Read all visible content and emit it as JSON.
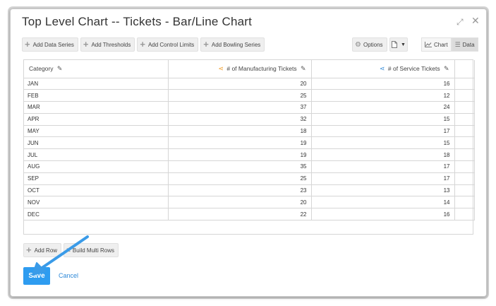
{
  "dialog": {
    "title": "Top Level Chart -- Tickets - Bar/Line Chart",
    "expand_glyph": "⤢",
    "close_glyph": "✕"
  },
  "toolbar": {
    "add_data_series": "Add Data Series",
    "add_thresholds": "Add Thresholds",
    "add_control_limits": "Add Control Limits",
    "add_bowling_series": "Add Bowling Series",
    "options": "Options",
    "chart_tab": "Chart",
    "data_tab": "Data",
    "active_tab": "Data"
  },
  "table": {
    "headers": {
      "category": "Category",
      "manufacturing": "# of Manufacturing Tickets",
      "service": "# of Service Tickets"
    },
    "rows": [
      {
        "category": "JAN",
        "mfg": "20",
        "svc": "16"
      },
      {
        "category": "FEB",
        "mfg": "25",
        "svc": "12"
      },
      {
        "category": "MAR",
        "mfg": "37",
        "svc": "24"
      },
      {
        "category": "APR",
        "mfg": "32",
        "svc": "15"
      },
      {
        "category": "MAY",
        "mfg": "18",
        "svc": "17"
      },
      {
        "category": "JUN",
        "mfg": "19",
        "svc": "15"
      },
      {
        "category": "JUL",
        "mfg": "19",
        "svc": "18"
      },
      {
        "category": "AUG",
        "mfg": "35",
        "svc": "17"
      },
      {
        "category": "SEP",
        "mfg": "25",
        "svc": "17"
      },
      {
        "category": "OCT",
        "mfg": "23",
        "svc": "13"
      },
      {
        "category": "NOV",
        "mfg": "20",
        "svc": "14"
      },
      {
        "category": "DEC",
        "mfg": "22",
        "svc": "16"
      }
    ]
  },
  "bottom": {
    "add_row": "Add Row",
    "build_multi_rows": "Build Multi Rows",
    "save": "Save",
    "cancel": "Cancel"
  },
  "colors": {
    "accent": "#2e9cf0",
    "manufacturing_series": "#f0a030",
    "service_series": "#3a8fd8",
    "annotation_arrow": "#3a9be8"
  },
  "icons": {
    "expand": "expand-icon",
    "close": "close-icon",
    "plus": "plus-icon",
    "gear": "gear-icon",
    "document": "document-icon",
    "pencil": "pencil-icon",
    "share": "share-icon",
    "chart": "line-chart-icon",
    "list": "list-icon"
  }
}
